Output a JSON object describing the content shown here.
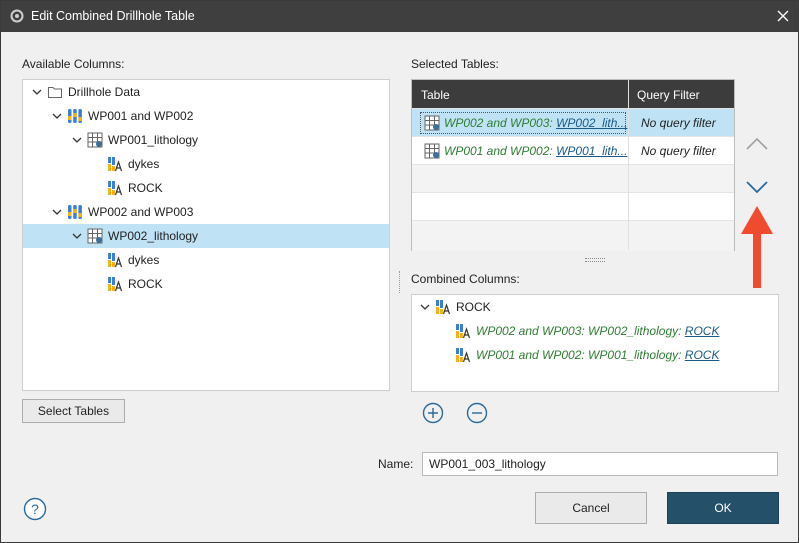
{
  "window": {
    "title": "Edit Combined Drillhole Table"
  },
  "available_columns": {
    "label": "Available Columns:",
    "tree": [
      {
        "label": "Drillhole Data",
        "icon": "folder-icon",
        "level": 0,
        "expanded": true
      },
      {
        "label": "WP001 and WP002",
        "icon": "drillhole-set-icon",
        "level": 1,
        "expanded": true
      },
      {
        "label": "WP001_lithology",
        "icon": "table-icon",
        "level": 2,
        "expanded": true
      },
      {
        "label": "dykes",
        "icon": "category-column-icon",
        "level": 3
      },
      {
        "label": "ROCK",
        "icon": "category-column-icon",
        "level": 3
      },
      {
        "label": "WP002 and WP003",
        "icon": "drillhole-set-icon",
        "level": 1,
        "expanded": true
      },
      {
        "label": "WP002_lithology",
        "icon": "table-icon",
        "level": 2,
        "expanded": true,
        "selected": true
      },
      {
        "label": "dykes",
        "icon": "category-column-icon",
        "level": 3
      },
      {
        "label": "ROCK",
        "icon": "category-column-icon",
        "level": 3
      }
    ]
  },
  "select_tables_button": "Select Tables",
  "selected_tables": {
    "label": "Selected Tables:",
    "col_table": "Table",
    "col_query": "Query Filter",
    "rows": [
      {
        "prefix": "WP002 and WP003: ",
        "link": "WP002_lith...",
        "filter": "No query filter",
        "selected": true
      },
      {
        "prefix": "WP001 and WP002: ",
        "link": "WP001_lith...",
        "filter": "No query filter",
        "selected": false
      }
    ]
  },
  "combined_columns": {
    "label": "Combined Columns:",
    "root": "ROCK",
    "items": [
      {
        "prefix": "WP002 and WP003: WP002_lithology: ",
        "link": "ROCK"
      },
      {
        "prefix": "WP001 and WP002: WP001_lithology: ",
        "link": "ROCK"
      }
    ]
  },
  "name_field": {
    "label": "Name:",
    "value": "WP001_003_lithology"
  },
  "buttons": {
    "cancel": "Cancel",
    "ok": "OK"
  },
  "colors": {
    "accent": "#24506a",
    "selection": "#bfe3f4",
    "arrow": "#f04a2f",
    "green_text": "#2e7d32"
  }
}
